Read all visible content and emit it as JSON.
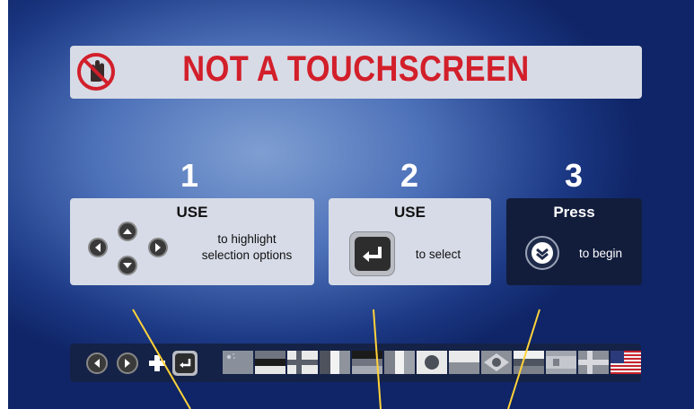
{
  "banner": {
    "title": "NOT A TOUCHSCREEN",
    "icon": "no-touch-icon"
  },
  "steps": [
    {
      "number": "1",
      "heading": "USE",
      "text_line1": "to highlight",
      "text_line2": "selection options",
      "icon": "dpad-arrows-icon"
    },
    {
      "number": "2",
      "heading": "USE",
      "text": "to select",
      "icon": "enter-key-icon"
    },
    {
      "number": "3",
      "heading": "Press",
      "text": "to begin",
      "icon": "down-chevron-button-icon"
    }
  ],
  "language_bar": {
    "controls": [
      "left-arrow-icon",
      "right-arrow-icon",
      "plus-icon",
      "enter-key-icon"
    ],
    "flags": [
      "china",
      "estonia-like",
      "finland-like",
      "france-like",
      "germany-like",
      "ireland-like",
      "japan",
      "poland-like",
      "brazil",
      "russia-like",
      "spain",
      "sweden-like",
      "usa"
    ]
  },
  "colors": {
    "title_red": "#d21f2a",
    "card_light": "#d6dbe7",
    "card_dark": "#121d3c",
    "callout_yellow": "#ffd23a"
  }
}
